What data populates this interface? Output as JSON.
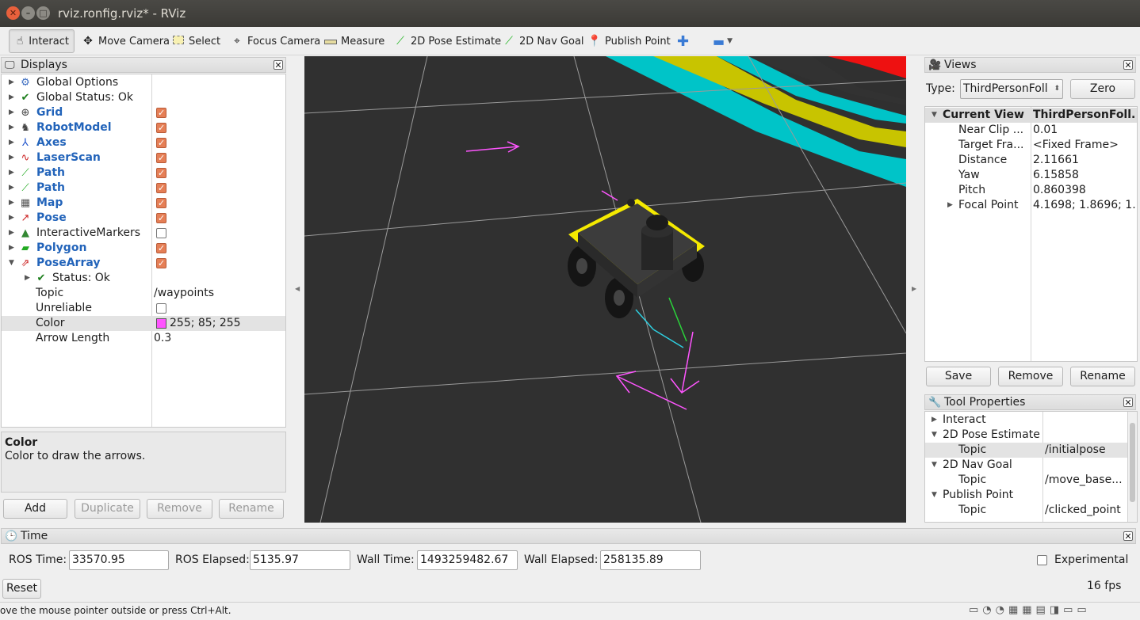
{
  "window": {
    "title": "rviz.ronfig.rviz* - RViz"
  },
  "toolbar": {
    "interact": "Interact",
    "move_camera": "Move Camera",
    "select": "Select",
    "focus_camera": "Focus Camera",
    "measure": "Measure",
    "pose_estimate": "2D Pose Estimate",
    "nav_goal": "2D Nav Goal",
    "publish_point": "Publish Point"
  },
  "displays": {
    "title": "Displays",
    "items": [
      {
        "label": "Global Options",
        "icon": "gear-icon"
      },
      {
        "label": "Global Status: Ok",
        "icon": "check-icon"
      },
      {
        "label": "Grid",
        "icon": "grid-icon",
        "checked": true
      },
      {
        "label": "RobotModel",
        "icon": "robot-icon",
        "checked": true
      },
      {
        "label": "Axes",
        "icon": "axes-icon",
        "checked": true
      },
      {
        "label": "LaserScan",
        "icon": "laserscan-icon",
        "checked": true
      },
      {
        "label": "Path",
        "icon": "path-icon",
        "checked": true
      },
      {
        "label": "Path",
        "icon": "path-icon",
        "checked": true
      },
      {
        "label": "Map",
        "icon": "map-icon",
        "checked": true
      },
      {
        "label": "Pose",
        "icon": "pose-icon",
        "checked": true
      },
      {
        "label": "InteractiveMarkers",
        "icon": "markers-icon",
        "checked": false
      },
      {
        "label": "Polygon",
        "icon": "polygon-icon",
        "checked": true
      },
      {
        "label": "PoseArray",
        "icon": "posearray-icon",
        "checked": true
      }
    ],
    "sub": {
      "status": "Status: Ok",
      "topic_label": "Topic",
      "topic_value": "/waypoints",
      "unreliable_label": "Unreliable",
      "color_label": "Color",
      "color_value": "255; 85; 255",
      "arrow_label": "Arrow Length",
      "arrow_value": "0.3"
    },
    "desc_title": "Color",
    "desc_text": "Color to draw the arrows.",
    "buttons": {
      "add": "Add",
      "duplicate": "Duplicate",
      "remove": "Remove",
      "rename": "Rename"
    }
  },
  "views": {
    "title": "Views",
    "type_label": "Type:",
    "type_value": "ThirdPersonFoll",
    "zero": "Zero",
    "header_key": "Current View",
    "header_val": "ThirdPersonFoll...",
    "props": [
      {
        "k": "Near Clip ...",
        "v": "0.01"
      },
      {
        "k": "Target Fra...",
        "v": "<Fixed Frame>"
      },
      {
        "k": "Distance",
        "v": "2.11661"
      },
      {
        "k": "Yaw",
        "v": "6.15858"
      },
      {
        "k": "Pitch",
        "v": "0.860398"
      },
      {
        "k": "Focal Point",
        "v": "4.1698; 1.8696; 1..."
      }
    ],
    "buttons": {
      "save": "Save",
      "remove": "Remove",
      "rename": "Rename"
    }
  },
  "tool_props": {
    "title": "Tool Properties",
    "rows": [
      {
        "k": "Interact",
        "v": ""
      },
      {
        "k": "2D Pose Estimate",
        "v": ""
      },
      {
        "k": "Topic",
        "v": "/initialpose"
      },
      {
        "k": "2D Nav Goal",
        "v": ""
      },
      {
        "k": "Topic",
        "v": "/move_base..."
      },
      {
        "k": "Publish Point",
        "v": ""
      },
      {
        "k": "Topic",
        "v": "/clicked_point"
      }
    ]
  },
  "time": {
    "title": "Time",
    "ros_time_label": "ROS Time:",
    "ros_time": "33570.95",
    "ros_elapsed_label": "ROS Elapsed:",
    "ros_elapsed": "5135.97",
    "wall_time_label": "Wall Time:",
    "wall_time": "1493259482.67",
    "wall_elapsed_label": "Wall Elapsed:",
    "wall_elapsed": "258135.89",
    "experimental": "Experimental"
  },
  "footer": {
    "reset": "Reset",
    "fps": "16 fps",
    "status": "ove the mouse pointer outside or press Ctrl+Alt."
  },
  "colors": {
    "accent": "#2364ba",
    "checkbox": "#e57f56",
    "pose_color": "#ff55ff"
  }
}
